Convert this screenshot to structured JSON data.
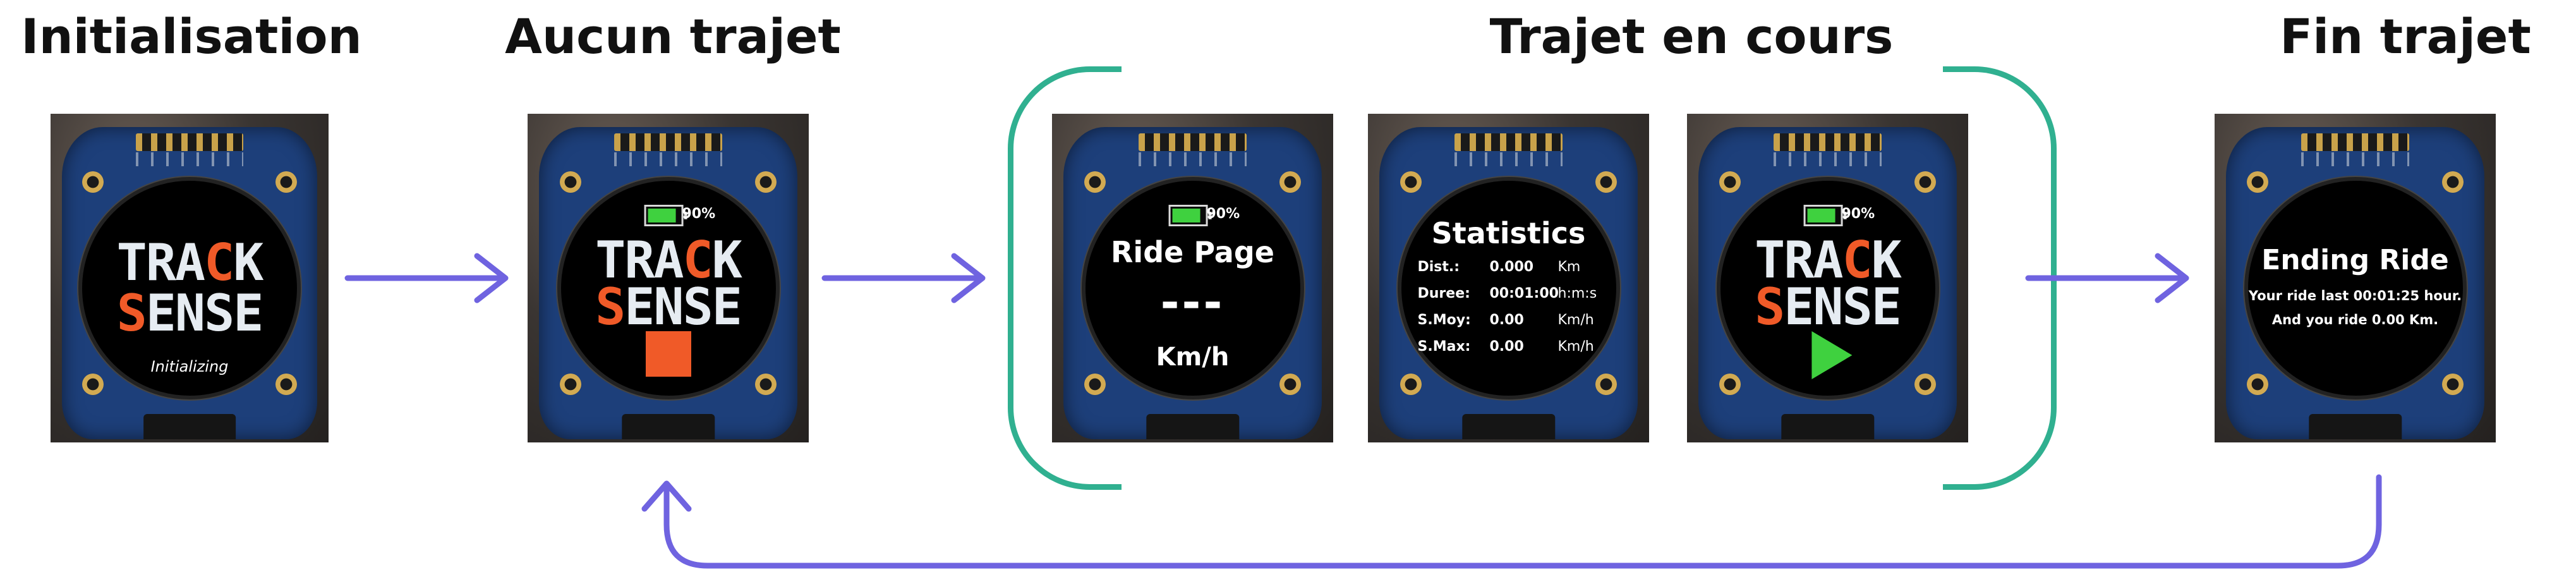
{
  "colors": {
    "arrow": "#6f63e0",
    "bracket": "#30b090",
    "logo_accent": "#f05a28",
    "battery_fill": "#3fd13f",
    "stop_button": "#f05a28",
    "play_button": "#3fd13f"
  },
  "stages": [
    {
      "title": "Initialisation"
    },
    {
      "title": "Aucun trajet"
    },
    {
      "title": "Trajet en cours"
    },
    {
      "title": "Fin trajet"
    }
  ],
  "screens": {
    "init": {
      "logo_line1": {
        "a": "TRA",
        "accent": "C",
        "b": "K"
      },
      "logo_line2": {
        "a": "",
        "accent": "S",
        "b": "ENSE"
      },
      "status": "Initializing"
    },
    "idle": {
      "battery_level": 0.9,
      "battery_text": "90%",
      "logo_line1": {
        "a": "TRA",
        "accent": "C",
        "b": "K"
      },
      "logo_line2": {
        "a": "",
        "accent": "S",
        "b": "ENSE"
      },
      "button_icon": "stop-square-icon"
    },
    "ride": {
      "battery_level": 0.9,
      "battery_text": "90%",
      "title": "Ride Page",
      "speed": "---",
      "unit": "Km/h"
    },
    "stats": {
      "title": "Statistics",
      "rows": [
        {
          "label": "Dist.:",
          "value": "0.000",
          "unit": "Km"
        },
        {
          "label": "Duree:",
          "value": "00:01:00",
          "unit": "h:m:s"
        },
        {
          "label": "S.Moy:",
          "value": "0.00",
          "unit": "Km/h"
        },
        {
          "label": "S.Max:",
          "value": "0.00",
          "unit": "Km/h"
        }
      ]
    },
    "paused": {
      "battery_level": 0.9,
      "battery_text": "90%",
      "logo_line1": {
        "a": "TRA",
        "accent": "C",
        "b": "K"
      },
      "logo_line2": {
        "a": "",
        "accent": "S",
        "b": "ENSE"
      },
      "button_icon": "play-triangle-icon"
    },
    "end": {
      "title": "Ending Ride",
      "line1": "Your ride last 00:01:25 hour.",
      "line2": "And you ride 0.00 Km."
    }
  }
}
